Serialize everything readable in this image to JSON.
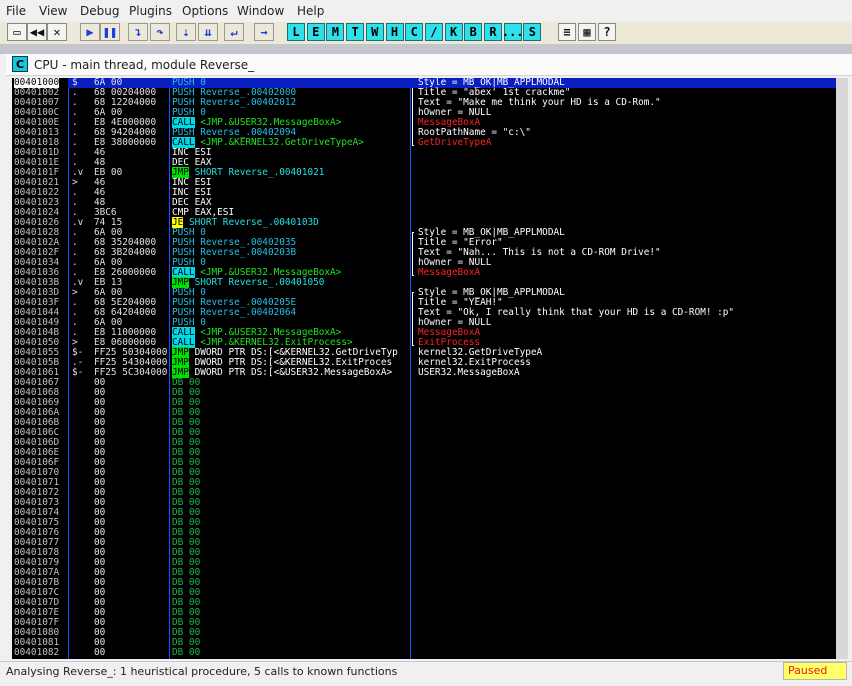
{
  "menu": [
    "File",
    "View",
    "Debug",
    "Plugins",
    "Options",
    "Window",
    "Help"
  ],
  "toolbar": {
    "buttons": [
      {
        "name": "open-file-icon",
        "glyph": "▭"
      },
      {
        "name": "rewind-icon",
        "glyph": "◀◀"
      },
      {
        "name": "close-icon",
        "glyph": "✕"
      },
      {
        "name": "run-icon",
        "glyph": "▶"
      },
      {
        "name": "pause-icon",
        "glyph": "❚❚"
      },
      {
        "name": "step-into-icon",
        "glyph": "↴"
      },
      {
        "name": "step-over-icon",
        "glyph": "↷"
      },
      {
        "name": "trace-into-icon",
        "glyph": "⇣"
      },
      {
        "name": "trace-over-icon",
        "glyph": "⇊"
      },
      {
        "name": "execute-till-return-icon",
        "glyph": "↵"
      },
      {
        "name": "goto-icon",
        "glyph": "→"
      }
    ],
    "letters": [
      "L",
      "E",
      "M",
      "T",
      "W",
      "H",
      "C",
      "/",
      "K",
      "B",
      "R",
      "...",
      "S"
    ],
    "right_buttons": [
      {
        "name": "list-icon",
        "glyph": "≡"
      },
      {
        "name": "grid-icon",
        "glyph": "▦"
      },
      {
        "name": "help-icon",
        "glyph": "?"
      }
    ]
  },
  "cpu_window": {
    "icon_letter": "C",
    "title": "CPU - main thread, module Reverse_"
  },
  "rows": [
    {
      "addr": "00401000",
      "mark": "$",
      "hex": "6A 00",
      "mn": "PUSH 0",
      "kind": "push",
      "sel": true,
      "cm": "Style = MB_OK|MB_APPLMODAL"
    },
    {
      "addr": "00401002",
      "mark": ".",
      "hex": "68 00204000",
      "mn": "PUSH Reverse_.00402000",
      "kind": "push",
      "cm": "Title = \"abex' 1st crackme\""
    },
    {
      "addr": "00401007",
      "mark": ".",
      "hex": "68 12204000",
      "mn": "PUSH Reverse_.00402012",
      "kind": "push",
      "cm": "Text = \"Make me think your HD is a CD-Rom.\""
    },
    {
      "addr": "0040100C",
      "mark": ".",
      "hex": "6A 00",
      "mn": "PUSH 0",
      "kind": "push",
      "cm": "hOwner = NULL"
    },
    {
      "addr": "0040100E",
      "mark": ".",
      "hex": "E8 4E000000",
      "op": "CALL",
      "rest": " <JMP.&USER32.MessageBoxA>",
      "kind": "call",
      "cm": "MessageBoxA",
      "cmred": true
    },
    {
      "addr": "00401013",
      "mark": ".",
      "hex": "68 94204000",
      "mn": "PUSH Reverse_.00402094",
      "kind": "push",
      "cm": "RootPathName = \"c:\\\""
    },
    {
      "addr": "00401018",
      "mark": ".",
      "hex": "E8 38000000",
      "op": "CALL",
      "rest": " <JMP.&KERNEL32.GetDriveTypeA>",
      "kind": "call",
      "cm": "GetDriveTypeA",
      "cmred": true
    },
    {
      "addr": "0040101D",
      "mark": ".",
      "hex": "46",
      "mn": "INC ESI",
      "kind": "plain"
    },
    {
      "addr": "0040101E",
      "mark": ".",
      "hex": "48",
      "mn": "DEC EAX",
      "kind": "plain"
    },
    {
      "addr": "0040101F",
      "mark": ".v",
      "hex": "EB 00",
      "op": "JMP",
      "rest": " SHORT Reverse_.00401021",
      "kind": "jmp"
    },
    {
      "addr": "00401021",
      "mark": ">",
      "hex": "46",
      "mn": "INC ESI",
      "kind": "plain"
    },
    {
      "addr": "00401022",
      "mark": ".",
      "hex": "46",
      "mn": "INC ESI",
      "kind": "plain"
    },
    {
      "addr": "00401023",
      "mark": ".",
      "hex": "48",
      "mn": "DEC EAX",
      "kind": "plain"
    },
    {
      "addr": "00401024",
      "mark": ".",
      "hex": "3BC6",
      "mn": "CMP EAX,ESI",
      "kind": "plain"
    },
    {
      "addr": "00401026",
      "mark": ".v",
      "hex": "74 15",
      "op": "JE",
      "rest": " SHORT Reverse_.0040103D",
      "kind": "je"
    },
    {
      "addr": "00401028",
      "mark": ".",
      "hex": "6A 00",
      "mn": "PUSH 0",
      "kind": "push",
      "cm": "Style = MB_OK|MB_APPLMODAL"
    },
    {
      "addr": "0040102A",
      "mark": ".",
      "hex": "68 35204000",
      "mn": "PUSH Reverse_.00402035",
      "kind": "push",
      "cm": "Title = \"Error\""
    },
    {
      "addr": "0040102F",
      "mark": ".",
      "hex": "68 3B204000",
      "mn": "PUSH Reverse_.0040203B",
      "kind": "push",
      "cm": "Text = \"Nah... This is not a CD-ROM Drive!\""
    },
    {
      "addr": "00401034",
      "mark": ".",
      "hex": "6A 00",
      "mn": "PUSH 0",
      "kind": "push",
      "cm": "hOwner = NULL"
    },
    {
      "addr": "00401036",
      "mark": ".",
      "hex": "E8 26000000",
      "op": "CALL",
      "rest": " <JMP.&USER32.MessageBoxA>",
      "kind": "call",
      "cm": "MessageBoxA",
      "cmred": true
    },
    {
      "addr": "0040103B",
      "mark": ".v",
      "hex": "EB 13",
      "op": "JMP",
      "rest": " SHORT Reverse_.00401050",
      "kind": "jmp"
    },
    {
      "addr": "0040103D",
      "mark": ">",
      "hex": "6A 00",
      "mn": "PUSH 0",
      "kind": "push",
      "cm": "Style = MB_OK|MB_APPLMODAL"
    },
    {
      "addr": "0040103F",
      "mark": ".",
      "hex": "68 5E204000",
      "mn": "PUSH Reverse_.0040205E",
      "kind": "push",
      "cm": "Title = \"YEAH!\""
    },
    {
      "addr": "00401044",
      "mark": ".",
      "hex": "68 64204000",
      "mn": "PUSH Reverse_.00402064",
      "kind": "push",
      "cm": "Text = \"Ok, I really think that your HD is a CD-ROM! :p\""
    },
    {
      "addr": "00401049",
      "mark": ".",
      "hex": "6A 00",
      "mn": "PUSH 0",
      "kind": "push",
      "cm": "hOwner = NULL"
    },
    {
      "addr": "0040104B",
      "mark": ".",
      "hex": "E8 11000000",
      "op": "CALL",
      "rest": " <JMP.&USER32.MessageBoxA>",
      "kind": "call",
      "cm": "MessageBoxA",
      "cmred": true
    },
    {
      "addr": "00401050",
      "mark": ">",
      "hex": "E8 06000000",
      "op": "CALL",
      "rest": " <JMP.&KERNEL32.ExitProcess>",
      "kind": "call",
      "cm": "ExitProcess",
      "cmred": true
    },
    {
      "addr": "00401055",
      "mark": "$-",
      "hex": "FF25 50304000",
      "op": "JMP",
      "rest": " DWORD PTR DS:[<&KERNEL32.GetDriveTyp",
      "kind": "jmpw",
      "cm": "kernel32.GetDriveTypeA"
    },
    {
      "addr": "0040105B",
      "mark": ".-",
      "hex": "FF25 54304000",
      "op": "JMP",
      "rest": " DWORD PTR DS:[<&KERNEL32.ExitProces",
      "kind": "jmpw",
      "cm": "kernel32.ExitProcess"
    },
    {
      "addr": "00401061",
      "mark": "$-",
      "hex": "FF25 5C304000",
      "op": "JMP",
      "rest": " DWORD PTR DS:[<&USER32.MessageBoxA>",
      "kind": "jmpw",
      "cm": "USER32.MessageBoxA"
    },
    {
      "addr": "00401067",
      "mark": "",
      "hex": "00",
      "mn": "DB 00",
      "kind": "db"
    },
    {
      "addr": "00401068",
      "mark": "",
      "hex": "00",
      "mn": "DB 00",
      "kind": "db"
    },
    {
      "addr": "00401069",
      "mark": "",
      "hex": "00",
      "mn": "DB 00",
      "kind": "db"
    },
    {
      "addr": "0040106A",
      "mark": "",
      "hex": "00",
      "mn": "DB 00",
      "kind": "db"
    },
    {
      "addr": "0040106B",
      "mark": "",
      "hex": "00",
      "mn": "DB 00",
      "kind": "db"
    },
    {
      "addr": "0040106C",
      "mark": "",
      "hex": "00",
      "mn": "DB 00",
      "kind": "db"
    },
    {
      "addr": "0040106D",
      "mark": "",
      "hex": "00",
      "mn": "DB 00",
      "kind": "db"
    },
    {
      "addr": "0040106E",
      "mark": "",
      "hex": "00",
      "mn": "DB 00",
      "kind": "db"
    },
    {
      "addr": "0040106F",
      "mark": "",
      "hex": "00",
      "mn": "DB 00",
      "kind": "db"
    },
    {
      "addr": "00401070",
      "mark": "",
      "hex": "00",
      "mn": "DB 00",
      "kind": "db"
    },
    {
      "addr": "00401071",
      "mark": "",
      "hex": "00",
      "mn": "DB 00",
      "kind": "db"
    },
    {
      "addr": "00401072",
      "mark": "",
      "hex": "00",
      "mn": "DB 00",
      "kind": "db"
    },
    {
      "addr": "00401073",
      "mark": "",
      "hex": "00",
      "mn": "DB 00",
      "kind": "db"
    },
    {
      "addr": "00401074",
      "mark": "",
      "hex": "00",
      "mn": "DB 00",
      "kind": "db"
    },
    {
      "addr": "00401075",
      "mark": "",
      "hex": "00",
      "mn": "DB 00",
      "kind": "db"
    },
    {
      "addr": "00401076",
      "mark": "",
      "hex": "00",
      "mn": "DB 00",
      "kind": "db"
    },
    {
      "addr": "00401077",
      "mark": "",
      "hex": "00",
      "mn": "DB 00",
      "kind": "db"
    },
    {
      "addr": "00401078",
      "mark": "",
      "hex": "00",
      "mn": "DB 00",
      "kind": "db"
    },
    {
      "addr": "00401079",
      "mark": "",
      "hex": "00",
      "mn": "DB 00",
      "kind": "db"
    },
    {
      "addr": "0040107A",
      "mark": "",
      "hex": "00",
      "mn": "DB 00",
      "kind": "db"
    },
    {
      "addr": "0040107B",
      "mark": "",
      "hex": "00",
      "mn": "DB 00",
      "kind": "db"
    },
    {
      "addr": "0040107C",
      "mark": "",
      "hex": "00",
      "mn": "DB 00",
      "kind": "db"
    },
    {
      "addr": "0040107D",
      "mark": "",
      "hex": "00",
      "mn": "DB 00",
      "kind": "db"
    },
    {
      "addr": "0040107E",
      "mark": "",
      "hex": "00",
      "mn": "DB 00",
      "kind": "db"
    },
    {
      "addr": "0040107F",
      "mark": "",
      "hex": "00",
      "mn": "DB 00",
      "kind": "db"
    },
    {
      "addr": "00401080",
      "mark": "",
      "hex": "00",
      "mn": "DB 00",
      "kind": "db"
    },
    {
      "addr": "00401081",
      "mark": "",
      "hex": "00",
      "mn": "DB 00",
      "kind": "db"
    },
    {
      "addr": "00401082",
      "mark": "",
      "hex": "00",
      "mn": "DB 00",
      "kind": "db"
    }
  ],
  "status": {
    "message": "Analysing Reverse_: 1 heuristical procedure, 5 calls to known functions",
    "state": "Paused"
  },
  "colors": {
    "code_bg": "#000000",
    "selection": "#0a1fbf",
    "call_highlight": "#00d8e8",
    "jmp_highlight": "#00e000",
    "je_highlight": "#ffff00",
    "api_comment": "#ff2020",
    "paused_bg": "#ffff66"
  }
}
